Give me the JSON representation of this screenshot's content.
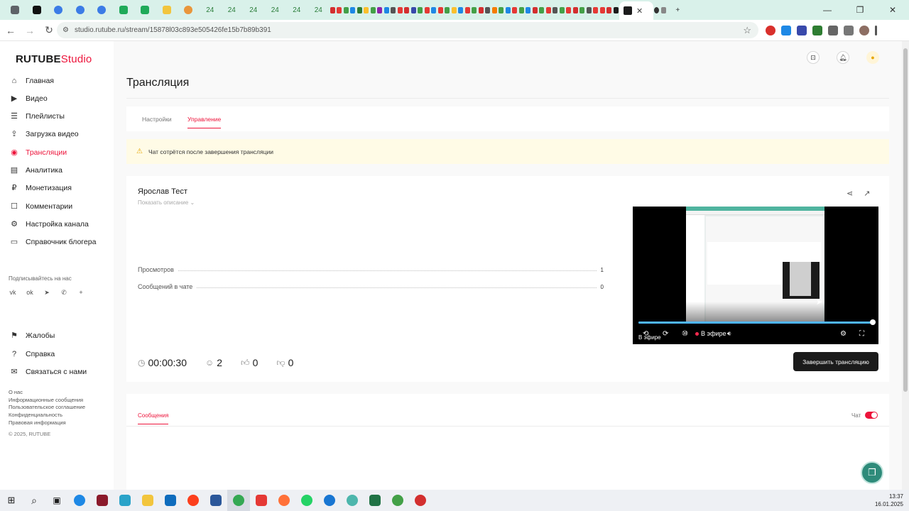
{
  "browser": {
    "tab_numbers": [
      "24",
      "24",
      "24",
      "24",
      "24",
      "24"
    ],
    "url": "studio.rutube.ru/stream/15878l03c893e505426fe15b7b89b391"
  },
  "sidebar": {
    "logo_brand": "RUTUBE",
    "logo_suffix": "Studio",
    "items": [
      {
        "label": "Главная",
        "icon": "home-icon"
      },
      {
        "label": "Видео",
        "icon": "video-icon"
      },
      {
        "label": "Плейлисты",
        "icon": "playlist-icon"
      },
      {
        "label": "Загрузка видео",
        "icon": "upload-icon"
      },
      {
        "label": "Трансляции",
        "icon": "broadcast-icon"
      },
      {
        "label": "Аналитика",
        "icon": "analytics-icon"
      },
      {
        "label": "Монетизация",
        "icon": "monetization-icon"
      },
      {
        "label": "Комментарии",
        "icon": "comments-icon"
      },
      {
        "label": "Настройка канала",
        "icon": "settings-icon"
      },
      {
        "label": "Справочник блогера",
        "icon": "book-icon"
      }
    ],
    "subscribe_label": "Подписывайтесь на нас",
    "bottom_items": [
      {
        "label": "Жалобы",
        "icon": "flag-icon"
      },
      {
        "label": "Справка",
        "icon": "help-icon"
      },
      {
        "label": "Связаться с нами",
        "icon": "mail-icon"
      }
    ],
    "footer_links": [
      "О нас",
      "Информационные сообщения",
      "Пользовательское соглашение",
      "Конфиденциальность",
      "Правовая информация"
    ],
    "copyright": "© 2025, RUTUBE"
  },
  "main": {
    "page_title": "Трансляция",
    "tabs": [
      "Настройки",
      "Управление"
    ],
    "active_tab": "Управление",
    "warning_text": "Чат сотрётся после завершения трансляции",
    "stream_name": "Ярослав Тест",
    "show_description": "Показать описание",
    "stats": [
      {
        "label": "Просмотров",
        "value": "1"
      },
      {
        "label": "Сообщений в чате",
        "value": "0"
      }
    ],
    "player": {
      "live_label": "В эфире",
      "tooltip_live": "В эфире",
      "progress": 1.0
    },
    "metrics": {
      "duration": "00:00:30",
      "viewers": "2",
      "likes": "0",
      "dislikes": "0"
    },
    "end_button": "Завершить трансляцию",
    "chat": {
      "tab_label": "Сообщения",
      "toggle_label": "Чат",
      "toggle_on": true
    }
  },
  "taskbar": {
    "time": "13:37",
    "date": "16.01.2025"
  },
  "colors": {
    "accent": "#ed143b",
    "warning_bg": "#fffbe6",
    "tab_strip": "#d9f1ea"
  }
}
